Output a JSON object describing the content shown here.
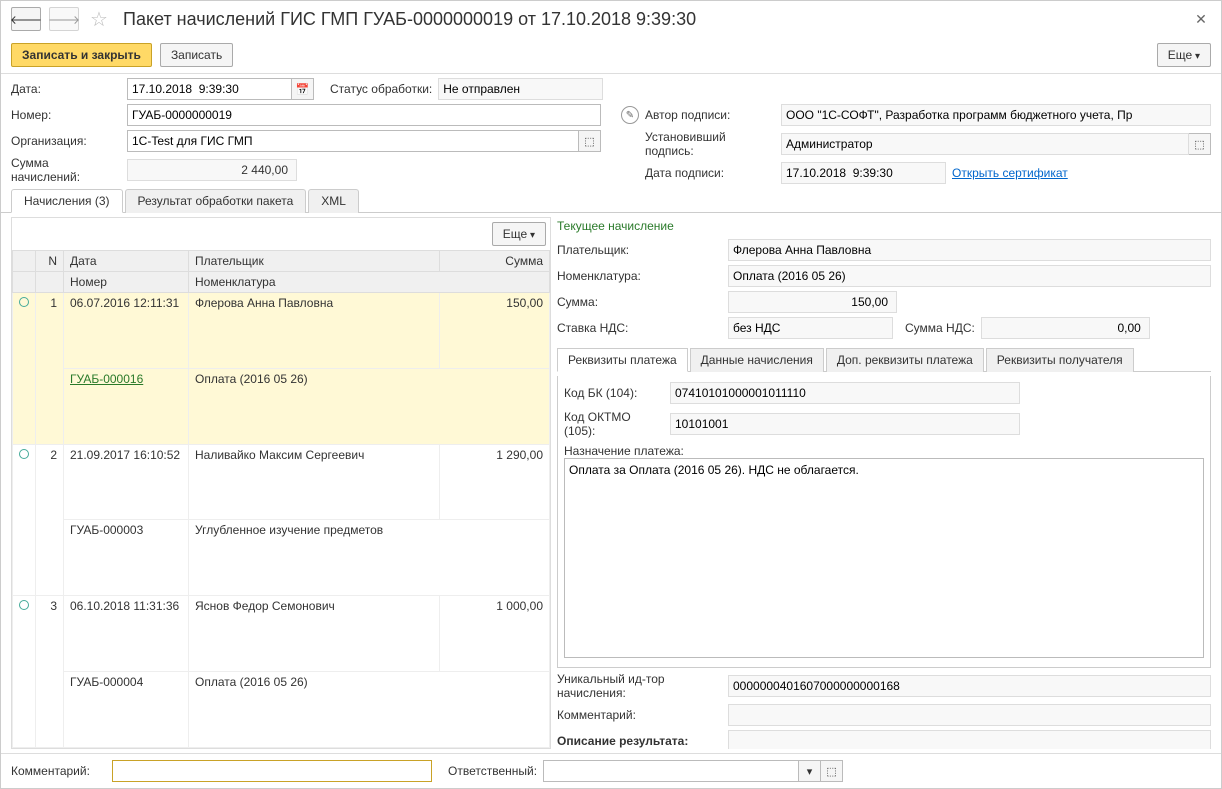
{
  "title": "Пакет начислений ГИС ГМП ГУАБ-0000000019 от 17.10.2018 9:39:30",
  "toolbar": {
    "save_close": "Записать и закрыть",
    "save": "Записать",
    "more": "Еще"
  },
  "header": {
    "date_label": "Дата:",
    "date_value": "17.10.2018  9:39:30",
    "status_label": "Статус обработки:",
    "status_value": "Не отправлен",
    "number_label": "Номер:",
    "number_value": "ГУАБ-0000000019",
    "author_label": "Автор подписи:",
    "author_value": "ООО \"1С-СОФТ\", Разработка программ бюджетного учета, Пр",
    "org_label": "Организация:",
    "org_value": "1С-Test для ГИС ГМП",
    "signer_label": "Установивший подпись:",
    "signer_value": "Администратор",
    "sum_label": "Сумма начислений:",
    "sum_value": "2 440,00",
    "sign_date_label": "Дата подписи:",
    "sign_date_value": "17.10.2018  9:39:30",
    "open_cert": "Открыть сертификат"
  },
  "tabs": {
    "t1": "Начисления (3)",
    "t2": "Результат обработки пакета",
    "t3": "XML"
  },
  "table": {
    "more": "Еще",
    "headers": {
      "n": "N",
      "date": "Дата",
      "payer": "Плательщик",
      "amount": "Сумма",
      "number": "Номер",
      "nomen": "Номенклатура"
    },
    "rows": [
      {
        "n": "1",
        "date": "06.07.2016 12:11:31",
        "payer": "Флерова Анна Павловна",
        "amount": "150,00",
        "number": "ГУАБ-000016",
        "nomen": "Оплата (2016 05 26)",
        "selected": true
      },
      {
        "n": "2",
        "date": "21.09.2017 16:10:52",
        "payer": "Наливайко Максим Сергеевич",
        "amount": "1 290,00",
        "number": "ГУАБ-000003",
        "nomen": "Углубленное изучение предметов",
        "selected": false
      },
      {
        "n": "3",
        "date": "06.10.2018 11:31:36",
        "payer": "Яснов Федор Семонович",
        "amount": "1 000,00",
        "number": "ГУАБ-000004",
        "nomen": "Оплата (2016 05 26)",
        "selected": false
      }
    ]
  },
  "detail": {
    "title": "Текущее начисление",
    "payer_label": "Плательщик:",
    "payer_value": "Флерова Анна Павловна",
    "nomen_label": "Номенклатура:",
    "nomen_value": "Оплата (2016 05 26)",
    "sum_label": "Сумма:",
    "sum_value": "150,00",
    "vat_rate_label": "Ставка НДС:",
    "vat_rate_value": "без НДС",
    "vat_sum_label": "Сумма НДС:",
    "vat_sum_value": "0,00",
    "subtabs": {
      "s1": "Реквизиты платежа",
      "s2": "Данные начисления",
      "s3": "Доп. реквизиты платежа",
      "s4": "Реквизиты получателя"
    },
    "kbk_label": "Код БК (104):",
    "kbk_value": "07410101000001011110",
    "oktmo_label": "Код ОКТМО (105):",
    "oktmo_value": "10101001",
    "purpose_label": "Назначение платежа:",
    "purpose_value": "Оплата за Оплата (2016 05 26). НДС не облагается.",
    "uid_label": "Уникальный ид-тор начисления:",
    "uid_value": "0000000401607000000000168",
    "comment_label": "Комментарий:",
    "comment_value": "",
    "result_label": "Описание результата:",
    "result_value": ""
  },
  "footer": {
    "comment_label": "Комментарий:",
    "comment_value": "",
    "responsible_label": "Ответственный:",
    "responsible_value": ""
  }
}
